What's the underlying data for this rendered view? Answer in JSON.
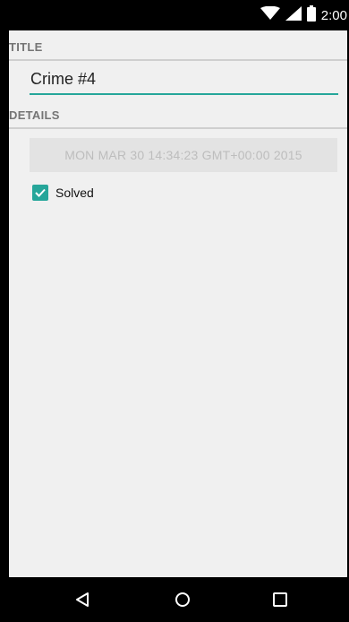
{
  "status_bar": {
    "time": "2:00",
    "icons": [
      "wifi-icon",
      "cellular-signal-icon",
      "battery-icon"
    ]
  },
  "title_section": {
    "header": "TITLE",
    "title_value": "Crime #4"
  },
  "details_section": {
    "header": "DETAILS",
    "date_button_label": "MON MAR 30 14:34:23 GMT+00:00 2015",
    "solved_label": "Solved",
    "solved_checked": true
  },
  "navigation_bar": {
    "buttons": [
      "back-icon",
      "home-icon",
      "recents-icon"
    ]
  },
  "colors": {
    "accent": "#26a69a",
    "background": "#f0f0f0",
    "date_button_bg": "#e3e3e3",
    "date_button_text": "#bdbdbd",
    "section_label": "#757575"
  }
}
